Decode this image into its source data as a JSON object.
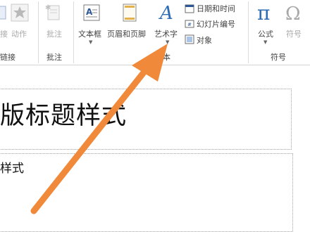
{
  "ribbon": {
    "links_group": {
      "action_label": "动作",
      "group_label": "链接"
    },
    "comments_group": {
      "comment_label": "批注",
      "group_label": "批注"
    },
    "text_group": {
      "textbox_label": "文本框",
      "header_footer_label": "页眉和页脚",
      "wordart_label": "艺术字",
      "datetime_label": "日期和时间",
      "slide_number_label": "幻灯片编号",
      "object_label": "对象",
      "group_label": "本"
    },
    "symbols_group": {
      "equation_label": "公式",
      "symbol_label": "符号",
      "group_label": "符号"
    }
  },
  "slide": {
    "title_text": "版标题样式",
    "subtitle_text": "样式"
  },
  "colors": {
    "accent_blue": "#2b5797",
    "arrow_orange": "#f0893a"
  }
}
